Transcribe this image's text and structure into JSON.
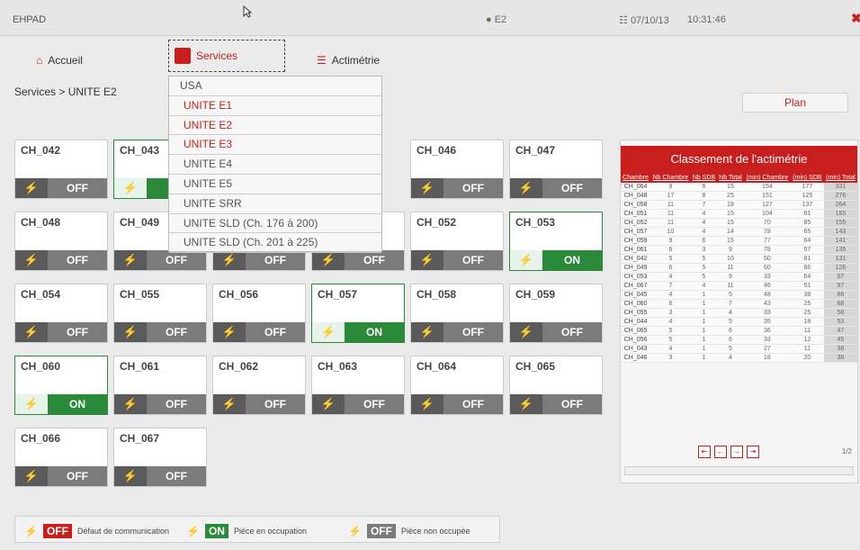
{
  "topbar": {
    "title": "EHPAD",
    "user": "E2",
    "date": "07/10/13",
    "time": "10:31:46"
  },
  "nav": {
    "home": "Accueil",
    "services": "Services",
    "actimetrie": "Actimétrie"
  },
  "breadcrumb": "Services > UNITE E2",
  "plan_button": "Plan",
  "dropdown": {
    "options": [
      "USA",
      "UNITE E1",
      "UNITE E2",
      "UNITE E3",
      "UNITE E4",
      "UNITE E5",
      "UNITE SRR",
      "UNITE SLD (Ch. 176 à 200)",
      "UNITE SLD (Ch. 201 à 225)"
    ]
  },
  "rooms": [
    {
      "name": "CH_042",
      "status": "OFF"
    },
    {
      "name": "CH_043",
      "status": "ON"
    },
    {
      "name": "CH_046",
      "status": "OFF"
    },
    {
      "name": "CH_047",
      "status": "OFF"
    },
    {
      "name": "CH_048",
      "status": "OFF"
    },
    {
      "name": "CH_049",
      "status": "OFF"
    },
    {
      "name": "",
      "status": "OFF"
    },
    {
      "name": "",
      "status": "OFF"
    },
    {
      "name": "CH_052",
      "status": "OFF"
    },
    {
      "name": "CH_053",
      "status": "ON"
    },
    {
      "name": "CH_054",
      "status": "OFF"
    },
    {
      "name": "CH_055",
      "status": "OFF"
    },
    {
      "name": "CH_056",
      "status": "OFF"
    },
    {
      "name": "CH_057",
      "status": "ON"
    },
    {
      "name": "CH_058",
      "status": "OFF"
    },
    {
      "name": "CH_059",
      "status": "OFF"
    },
    {
      "name": "CH_060",
      "status": "ON"
    },
    {
      "name": "CH_061",
      "status": "OFF"
    },
    {
      "name": "CH_062",
      "status": "OFF"
    },
    {
      "name": "CH_063",
      "status": "OFF"
    },
    {
      "name": "CH_064",
      "status": "OFF"
    },
    {
      "name": "CH_065",
      "status": "OFF"
    },
    {
      "name": "CH_066",
      "status": "OFF"
    },
    {
      "name": "CH_067",
      "status": "OFF"
    }
  ],
  "ranking": {
    "title": "Classement de l'actimétrie",
    "headers": [
      "Chambre",
      "Nb Chambre",
      "Nb SDB",
      "Nb Total",
      "(min) Chambre",
      "(min) SDB",
      "(min) Total"
    ],
    "rows": [
      [
        "CH_064",
        "9",
        "6",
        "15",
        "154",
        "177",
        "331"
      ],
      [
        "CH_048",
        "17",
        "8",
        "25",
        "151",
        "125",
        "276"
      ],
      [
        "CH_058",
        "11",
        "7",
        "18",
        "127",
        "137",
        "264"
      ],
      [
        "CH_051",
        "11",
        "4",
        "15",
        "104",
        "61",
        "165"
      ],
      [
        "CH_052",
        "11",
        "4",
        "15",
        "70",
        "85",
        "155"
      ],
      [
        "CH_057",
        "10",
        "4",
        "14",
        "78",
        "65",
        "143"
      ],
      [
        "CH_059",
        "9",
        "6",
        "15",
        "77",
        "64",
        "141"
      ],
      [
        "CH_061",
        "6",
        "3",
        "9",
        "78",
        "57",
        "135"
      ],
      [
        "CH_042",
        "5",
        "5",
        "10",
        "50",
        "81",
        "131"
      ],
      [
        "CH_049",
        "6",
        "5",
        "11",
        "60",
        "66",
        "126"
      ],
      [
        "CH_053",
        "4",
        "5",
        "9",
        "33",
        "64",
        "97"
      ],
      [
        "CH_067",
        "7",
        "4",
        "11",
        "46",
        "51",
        "97"
      ],
      [
        "CH_045",
        "4",
        "1",
        "5",
        "48",
        "38",
        "86"
      ],
      [
        "CH_060",
        "6",
        "1",
        "7",
        "43",
        "25",
        "68"
      ],
      [
        "CH_055",
        "3",
        "1",
        "4",
        "33",
        "25",
        "58"
      ],
      [
        "CH_044",
        "4",
        "1",
        "5",
        "35",
        "18",
        "53"
      ],
      [
        "CH_065",
        "5",
        "1",
        "6",
        "36",
        "11",
        "47"
      ],
      [
        "CH_056",
        "5",
        "1",
        "6",
        "33",
        "12",
        "45"
      ],
      [
        "CH_043",
        "4",
        "1",
        "5",
        "27",
        "11",
        "38"
      ],
      [
        "CH_046",
        "3",
        "1",
        "4",
        "18",
        "20",
        "38"
      ]
    ],
    "page": "1/2"
  },
  "legend": {
    "off_comm_label": "OFF",
    "off_comm": "Défaut de communication",
    "on_label": "ON",
    "on": "Pièce en occupation",
    "off_label": "OFF",
    "off": "Pièce non occupée"
  },
  "colors": {
    "accent": "#c81e1e",
    "on_green": "#2a8a3a",
    "off_grey": "#7b7b7b",
    "wifi_orange": "#ff6a14"
  }
}
